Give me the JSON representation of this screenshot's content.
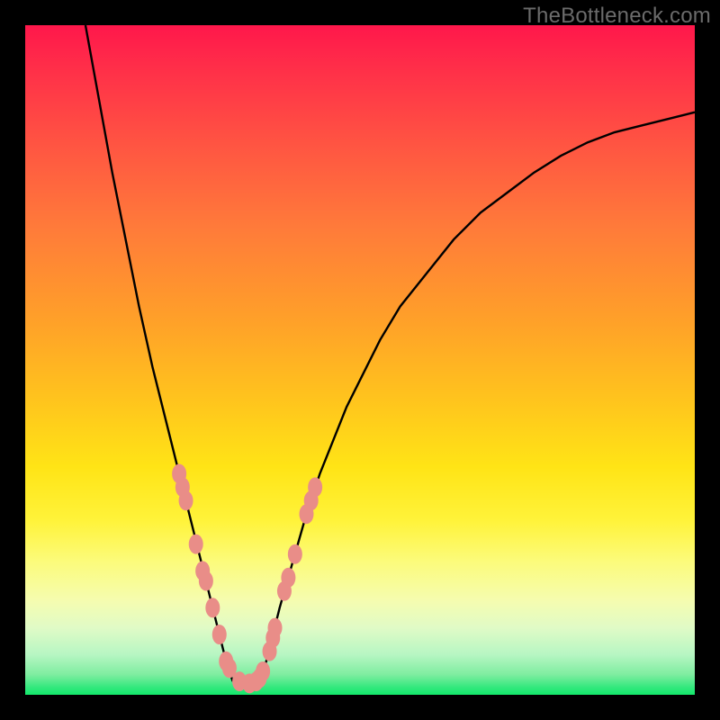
{
  "watermark": "TheBottleneck.com",
  "colors": {
    "curve_stroke": "#000000",
    "marker_fill": "#e98d88",
    "background_black": "#000000"
  },
  "chart_data": {
    "type": "line",
    "title": "",
    "xlabel": "",
    "ylabel": "",
    "xlim": [
      0,
      100
    ],
    "ylim": [
      0,
      100
    ],
    "grid": false,
    "legend": false,
    "annotations": [],
    "series": [
      {
        "name": "left-branch",
        "x": [
          9,
          11,
          13,
          15,
          17,
          19,
          20,
          21,
          22,
          23,
          24,
          25,
          26,
          27,
          28,
          29,
          30,
          31
        ],
        "y": [
          100,
          89,
          78,
          68,
          58,
          49,
          45,
          41,
          37,
          33,
          29,
          25,
          21,
          17,
          13,
          9,
          5,
          2
        ]
      },
      {
        "name": "valley-floor",
        "x": [
          31,
          32,
          33,
          34,
          35
        ],
        "y": [
          2,
          1.6,
          1.5,
          1.7,
          2
        ]
      },
      {
        "name": "right-branch",
        "x": [
          35,
          36,
          37,
          38,
          40,
          42,
          44,
          46,
          48,
          50,
          53,
          56,
          60,
          64,
          68,
          72,
          76,
          80,
          84,
          88,
          92,
          96,
          100
        ],
        "y": [
          2,
          5,
          9,
          13,
          20,
          27,
          33,
          38,
          43,
          47,
          53,
          58,
          63,
          68,
          72,
          75,
          78,
          80.5,
          82.5,
          84,
          85,
          86,
          87
        ]
      }
    ],
    "markers": [
      {
        "x": 23.0,
        "y": 33.0
      },
      {
        "x": 23.5,
        "y": 31.0
      },
      {
        "x": 24.0,
        "y": 29.0
      },
      {
        "x": 25.5,
        "y": 22.5
      },
      {
        "x": 26.5,
        "y": 18.5
      },
      {
        "x": 27.0,
        "y": 17.0
      },
      {
        "x": 28.0,
        "y": 13.0
      },
      {
        "x": 29.0,
        "y": 9.0
      },
      {
        "x": 30.0,
        "y": 5.0
      },
      {
        "x": 30.5,
        "y": 4.0
      },
      {
        "x": 32.0,
        "y": 2.0
      },
      {
        "x": 33.5,
        "y": 1.7
      },
      {
        "x": 34.5,
        "y": 2.0
      },
      {
        "x": 35.0,
        "y": 2.5
      },
      {
        "x": 35.5,
        "y": 3.5
      },
      {
        "x": 36.5,
        "y": 6.5
      },
      {
        "x": 37.0,
        "y": 8.5
      },
      {
        "x": 37.3,
        "y": 10.0
      },
      {
        "x": 38.7,
        "y": 15.5
      },
      {
        "x": 39.3,
        "y": 17.5
      },
      {
        "x": 40.3,
        "y": 21.0
      },
      {
        "x": 42.0,
        "y": 27.0
      },
      {
        "x": 42.7,
        "y": 29.0
      },
      {
        "x": 43.3,
        "y": 31.0
      }
    ]
  }
}
